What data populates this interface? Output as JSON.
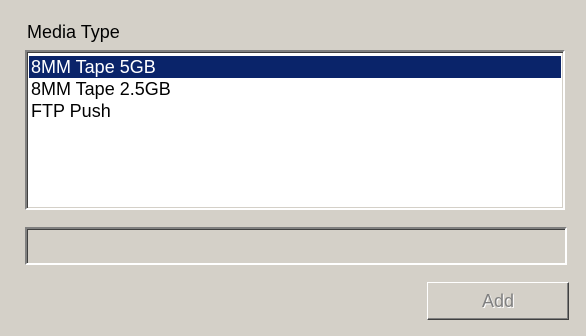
{
  "media_type_label": "Media Type",
  "media_list": {
    "items": [
      {
        "label": "8MM Tape 5GB",
        "selected": true
      },
      {
        "label": "8MM Tape 2.5GB",
        "selected": false
      },
      {
        "label": "FTP Push",
        "selected": false
      }
    ]
  },
  "name_field": {
    "value": ""
  },
  "add_button": {
    "label": "Add",
    "enabled": false
  },
  "colors": {
    "background": "#d4d0c8",
    "selection": "#0a246a",
    "disabled_text": "#808080"
  }
}
